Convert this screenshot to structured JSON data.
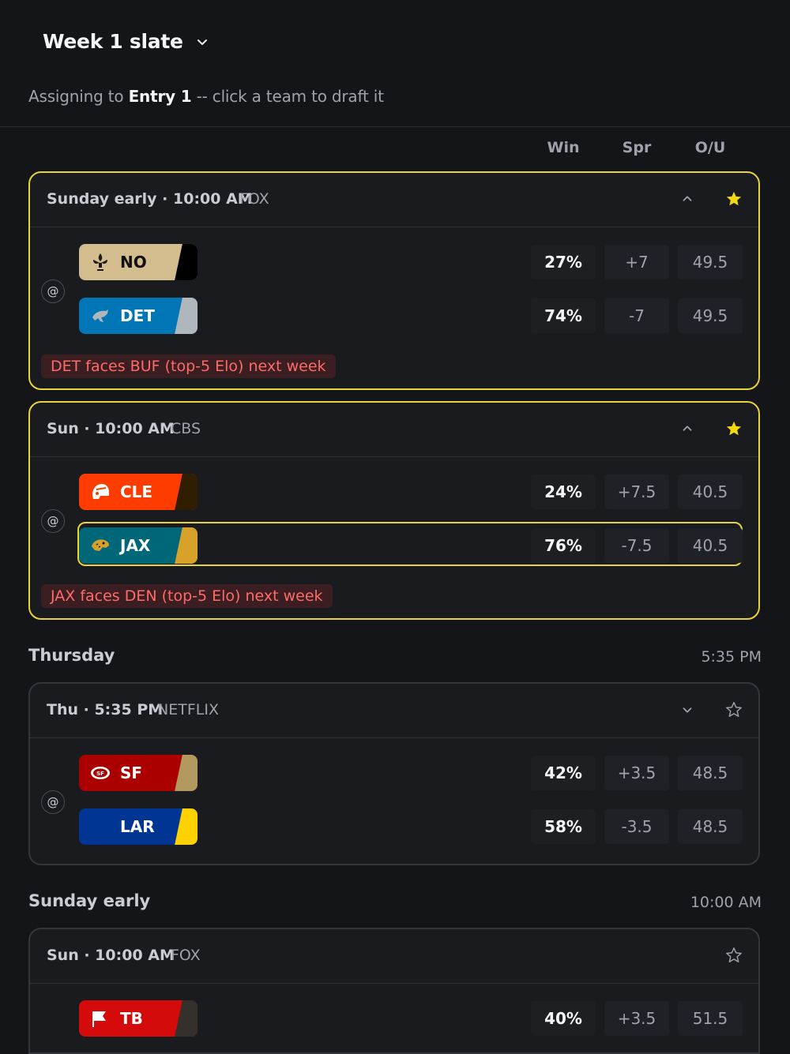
{
  "header": {
    "title": "Week 1 slate",
    "assign_prefix": "Assigning to ",
    "assign_entry": "Entry 1",
    "assign_suffix": " -- click a team to draft it"
  },
  "columns": {
    "win": "Win",
    "spread": "Spr",
    "ou": "O/U"
  },
  "games": [
    {
      "time": "Sunday early · 10:00 AM",
      "network": "FOX",
      "collapse_icon": "chevron-up-icon",
      "starred": true,
      "away": {
        "abbr": "NO",
        "win": "27%",
        "spread": "+7",
        "ou": "49.5",
        "bg": "#d3bc8d",
        "stripe": "#000000",
        "text": "#101010"
      },
      "home": {
        "abbr": "DET",
        "win": "74%",
        "spread": "-7",
        "ou": "49.5",
        "bg": "#0076b6",
        "stripe": "#b0b7bc",
        "text": "#ffffff"
      },
      "note": "DET faces BUF (top-5 Elo) next week"
    },
    {
      "time": "Sun · 10:00 AM",
      "network": "CBS",
      "collapse_icon": "chevron-up-icon",
      "starred": true,
      "away": {
        "abbr": "CLE",
        "win": "24%",
        "spread": "+7.5",
        "ou": "40.5",
        "bg": "#ff3c00",
        "stripe": "#311d00",
        "text": "#ffffff"
      },
      "home": {
        "abbr": "JAX",
        "win": "76%",
        "spread": "-7.5",
        "ou": "40.5",
        "bg": "#006778",
        "stripe": "#d7a22a",
        "text": "#ffffff",
        "selected": true
      },
      "note": "JAX faces DEN (top-5 Elo) next week"
    }
  ],
  "sections": [
    {
      "title": "Thursday",
      "time": "5:35 PM",
      "game": {
        "time": "Thu · 5:35 PM",
        "network": "NETFLIX",
        "collapse_icon": "chevron-down-icon",
        "starred": false,
        "away": {
          "abbr": "SF",
          "win": "42%",
          "spread": "+3.5",
          "ou": "48.5",
          "bg": "#aa0000",
          "stripe": "#b3995d",
          "text": "#ffffff"
        },
        "home": {
          "abbr": "LAR",
          "win": "58%",
          "spread": "-3.5",
          "ou": "48.5",
          "bg": "#003594",
          "stripe": "#ffd100",
          "text": "#ffffff"
        }
      }
    },
    {
      "title": "Sunday early",
      "time": "10:00 AM",
      "game": {
        "time": "Sun · 10:00 AM",
        "network": "FOX",
        "starred": false,
        "away": {
          "abbr": "TB",
          "win": "40%",
          "spread": "+3.5",
          "ou": "51.5",
          "bg": "#d50a0a",
          "stripe": "#34302b",
          "text": "#ffffff"
        }
      }
    }
  ],
  "colors": {
    "accent": "#e8d33a",
    "warning_text": "#ff6b66",
    "background": "#141518"
  }
}
